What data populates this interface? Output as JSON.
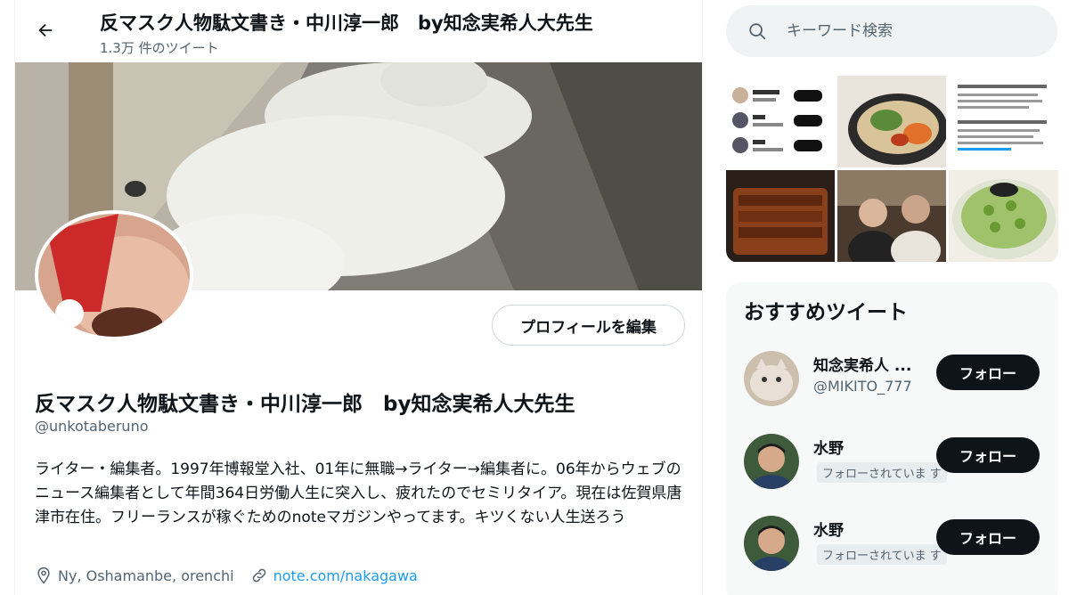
{
  "header": {
    "title": "反マスク人物駄文書き・中川淳一郎　by知念実希人大先生",
    "tweet_count": "1.3万 件のツイート"
  },
  "profile": {
    "edit_button": "プロフィールを編集",
    "name": "反マスク人物駄文書き・中川淳一郎　by知念実希人大先生",
    "handle": "@unkotaberuno",
    "bio": "ライター・編集者。1997年博報堂入社、01年に無職→ライター→編集者に。06年からウェブのニュース編集者として年間364日労働人生に突入し、疲れたのでセミリタイア。現在は佐賀県唐津市在住。フリーランスが稼ぐためのnoteマガジンやってます。キツくない人生送ろう",
    "location": "Ny, Oshamanbe, orenchi",
    "website": "note.com/nakagawa"
  },
  "search": {
    "placeholder": "キーワード検索"
  },
  "recommendations": {
    "title": "おすすめツイート",
    "items": [
      {
        "name": "知念実希人 ...",
        "sub": "@MIKITO_777",
        "follow_label": "フォロー"
      },
      {
        "name": "水野",
        "sub": "フォローされていま す",
        "follow_label": "フォロー"
      },
      {
        "name": "水野",
        "sub": "フォローされていま す",
        "follow_label": "フォロー"
      }
    ]
  },
  "icons": [
    "back-arrow-icon",
    "search-icon",
    "location-icon",
    "link-icon"
  ],
  "colors": {
    "accent": "#1d9bf0",
    "follow_bg": "#0f1419",
    "muted": "#536471"
  }
}
